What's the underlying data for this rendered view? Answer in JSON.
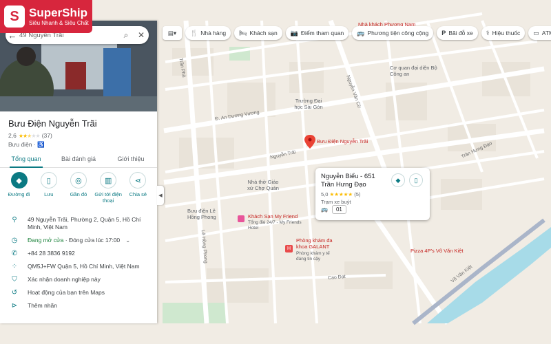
{
  "logo": {
    "name": "SuperShip",
    "tagline": "Siêu Nhanh & Siêu Chất"
  },
  "search": {
    "query": "49 Nguyễn Trãi"
  },
  "place": {
    "title": "Bưu Điện Nguyễn Trãi",
    "rating": "2,6",
    "rating_value": 2.6,
    "review_count": "(37)",
    "category": "Bưu điện",
    "category_icon": "wheelchair-icon"
  },
  "tabs": [
    "Tổng quan",
    "Bài đánh giá",
    "Giới thiệu"
  ],
  "actions": [
    {
      "label": "Đường đi",
      "icon": "directions-icon"
    },
    {
      "label": "Lưu",
      "icon": "bookmark-icon"
    },
    {
      "label": "Gần đó",
      "icon": "nearby-icon"
    },
    {
      "label": "Gửi tới điện thoại",
      "icon": "send-to-phone-icon"
    },
    {
      "label": "Chia sẻ",
      "icon": "share-icon"
    }
  ],
  "info": {
    "address": "49 Nguyễn Trãi, Phường 2, Quận 5, Hồ Chí Minh, Việt Nam",
    "hours_status": "Đang mở cửa",
    "hours_detail": "Đóng cửa lúc 17:00",
    "phone": "+84 28 3836 9192",
    "plus_code": "QM5J+FW Quận 5, Hồ Chí Minh, Việt Nam",
    "claim": "Xác nhận doanh nghiệp này",
    "activity": "Hoạt động của bạn trên Maps",
    "label": "Thêm nhãn"
  },
  "chips": [
    {
      "label": "Nhà hàng",
      "icon": "fork-knife-icon"
    },
    {
      "label": "Khách sạn",
      "icon": "bed-icon"
    },
    {
      "label": "Điểm tham quan",
      "icon": "camera-icon"
    },
    {
      "label": "Phương tiện công cộng",
      "icon": "bus-icon"
    },
    {
      "label": "Bãi đỗ xe",
      "icon": "parking-icon"
    },
    {
      "label": "Hiệu thuốc",
      "icon": "pharmacy-icon"
    },
    {
      "label": "ATM",
      "icon": "atm-icon"
    }
  ],
  "card": {
    "title": "Nguyễn Biểu - 651 Trần Hưng Đạo",
    "rating": "5,0",
    "review_count": "(5)",
    "category": "Trạm xe buýt",
    "route": "01"
  },
  "map_labels": {
    "marker": "Bưu Điện Nguyễn Trãi",
    "restaurant_top": "Nhà khách Phương Nam",
    "police": "Cơ quan đại diện Bộ Công an",
    "university": "Trường Đại học Sài Gòn",
    "church": "Nhà thờ Giáo xứ Chợ Quán",
    "post_office": "Bưu điện Lê Hồng Phong",
    "hotel": "Khách Sạn My Friend",
    "hotel_sub": "Tổng đài 24/7 - My Friends Hotel",
    "clinic": "Phòng khám đa khoa GALANT",
    "clinic_sub": "Phòng khám y tế đáng tin cậy",
    "pizza": "Pizza 4P's Võ Văn Kiệt",
    "road_avv": "Đ. An Dương Vương",
    "road_nt": "Nguyễn Trãi",
    "road_ncv": "Nguyễn Văn Cừ",
    "road_thd": "Trần Hưng Đạo",
    "road_lhp": "Lê Hồng Phong",
    "road_cd": "Cao Đạt",
    "road_vvk": "Võ Văn Kiệt",
    "road_tp": "Trần Phú"
  }
}
